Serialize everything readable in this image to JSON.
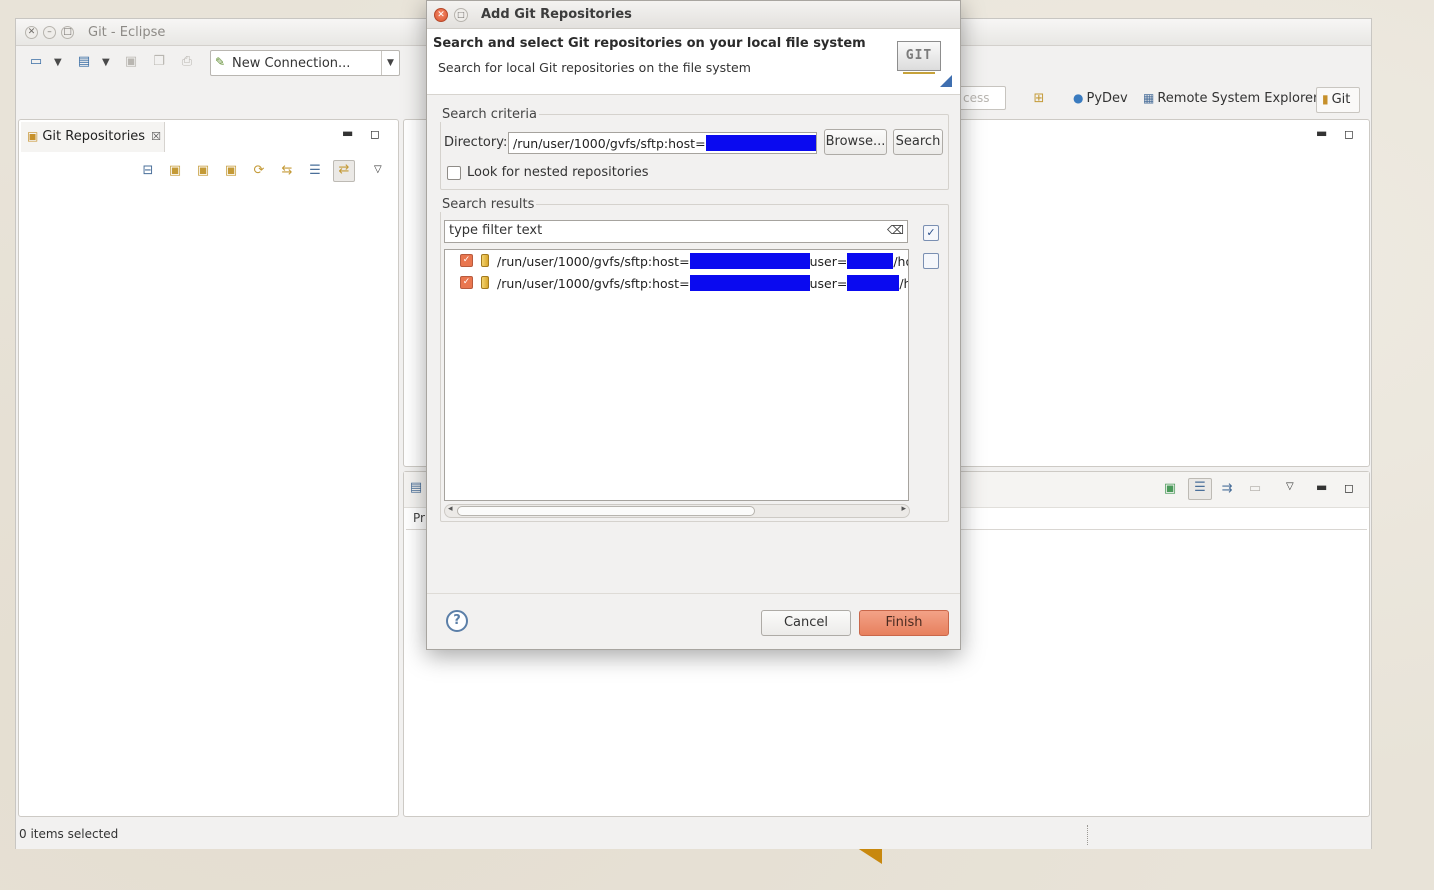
{
  "eclipse": {
    "title": "Git - Eclipse",
    "toolbar": {
      "new_connection": "New Connection..."
    },
    "quick_access_placeholder": "cess",
    "perspectives": [
      {
        "label": "PyDev",
        "icon": "pydev-icon"
      },
      {
        "label": "Remote System Explorer",
        "icon": "rse-icon"
      },
      {
        "label": "Git",
        "icon": "git-perspective-icon"
      }
    ],
    "git_view": {
      "tab_label": "Git Repositories"
    },
    "bottom_view": {
      "column_label": "Pr"
    },
    "status": {
      "text": "0 items selected"
    }
  },
  "dialog": {
    "title": "Add Git Repositories",
    "banner_heading": "Search and select Git repositories on your local file system",
    "banner_description": "Search for local Git repositories on the file system",
    "logo_text": "GIT",
    "search_criteria": {
      "group_label": "Search criteria",
      "directory_label": "Directory:",
      "directory_value_prefix": "/run/user/1000/gvfs/sftp:host=",
      "browse_label": "Browse...",
      "search_label": "Search",
      "nested_label": "Look for nested repositories",
      "nested_checked": false
    },
    "search_results": {
      "group_label": "Search results",
      "filter_placeholder": "type filter text",
      "rows": [
        {
          "prefix": "/run/user/1000/gvfs/sftp:host=",
          "middle": "user=",
          "suffix": "/hor",
          "checked": true
        },
        {
          "prefix": "/run/user/1000/gvfs/sftp:host=",
          "middle": "user=",
          "suffix": "/hor",
          "checked": true
        }
      ]
    },
    "cancel_label": "Cancel",
    "finish_label": "Finish"
  },
  "colors": {
    "accent_orange": "#e7805e",
    "redaction_blue": "#0a0af0",
    "git_logo_gold": "#c6a23a"
  }
}
